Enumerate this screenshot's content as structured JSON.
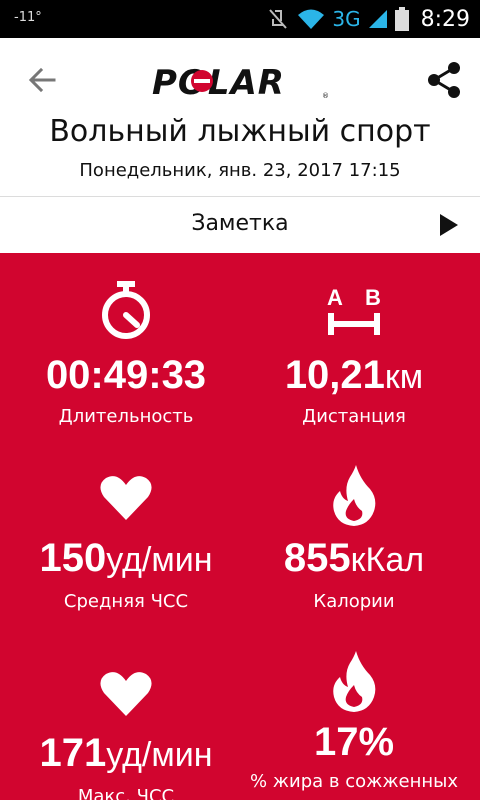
{
  "status_bar": {
    "temperature": "-11°",
    "network": "3G",
    "time": "8:29"
  },
  "app_bar": {
    "logo_text": "POLAR"
  },
  "session": {
    "title": "Вольный лыжный спорт",
    "datetime": "Понедельник, янв. 23, 2017 17:15"
  },
  "note": {
    "label": "Заметка"
  },
  "colors": {
    "panel": "#d1052f",
    "network": "#2bb5e8"
  },
  "metrics": [
    {
      "icon": "stopwatch-icon",
      "value": "00:49:33",
      "unit": "",
      "label": "Длительность"
    },
    {
      "icon": "distance-ab-icon",
      "value": "10,21",
      "unit": "км",
      "label": "Дистанция"
    },
    {
      "icon": "heart-icon",
      "value": "150",
      "unit": "уд/мин",
      "label": "Средняя ЧСС"
    },
    {
      "icon": "flame-icon",
      "value": "855",
      "unit": "кКал",
      "label": "Калории"
    },
    {
      "icon": "heart-icon",
      "value": "171",
      "unit": "уд/мин",
      "label": "Макс. ЧСС"
    },
    {
      "icon": "flame-icon",
      "value": "17%",
      "unit": "",
      "label": "% жира в сожженных"
    }
  ]
}
